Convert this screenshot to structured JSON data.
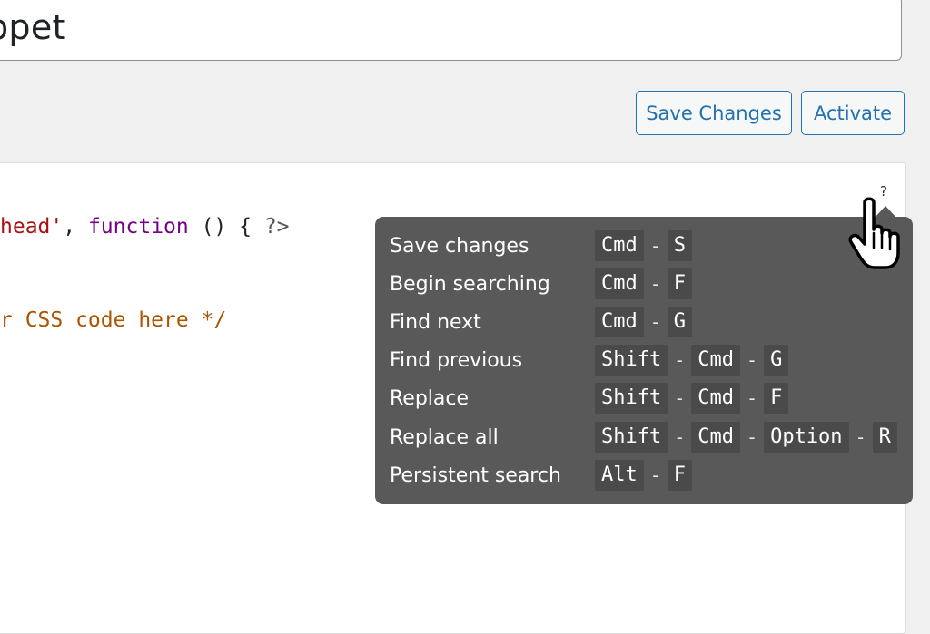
{
  "title_field": {
    "value": "ppet"
  },
  "actions": {
    "save_label": "Save Changes",
    "activate_label": "Activate"
  },
  "code_editor": {
    "line1": {
      "t1": "head'",
      "t2": ", ",
      "t3": "function",
      "t4": " () { ",
      "t5": "?>"
    },
    "line2": {
      "t1": "r CSS code here */"
    }
  },
  "help": {
    "icon": "?"
  },
  "shortcuts": [
    {
      "label": "Save changes",
      "keys": [
        "Cmd",
        "S"
      ]
    },
    {
      "label": "Begin searching",
      "keys": [
        "Cmd",
        "F"
      ]
    },
    {
      "label": "Find next",
      "keys": [
        "Cmd",
        "G"
      ]
    },
    {
      "label": "Find previous",
      "keys": [
        "Shift",
        "Cmd",
        "G"
      ]
    },
    {
      "label": "Replace",
      "keys": [
        "Shift",
        "Cmd",
        "F"
      ]
    },
    {
      "label": "Replace all",
      "keys": [
        "Shift",
        "Cmd",
        "Option",
        "R"
      ]
    },
    {
      "label": "Persistent search",
      "keys": [
        "Alt",
        "F"
      ]
    }
  ],
  "key_separator": "-",
  "colors": {
    "accent": "#2271b1",
    "tooltip_bg": "#595959",
    "background": "#f0f0f1",
    "code_string": "#aa1111",
    "code_keyword": "#770088",
    "code_comment": "#aa5500"
  },
  "cursor_icon": "hand-pointer-icon"
}
